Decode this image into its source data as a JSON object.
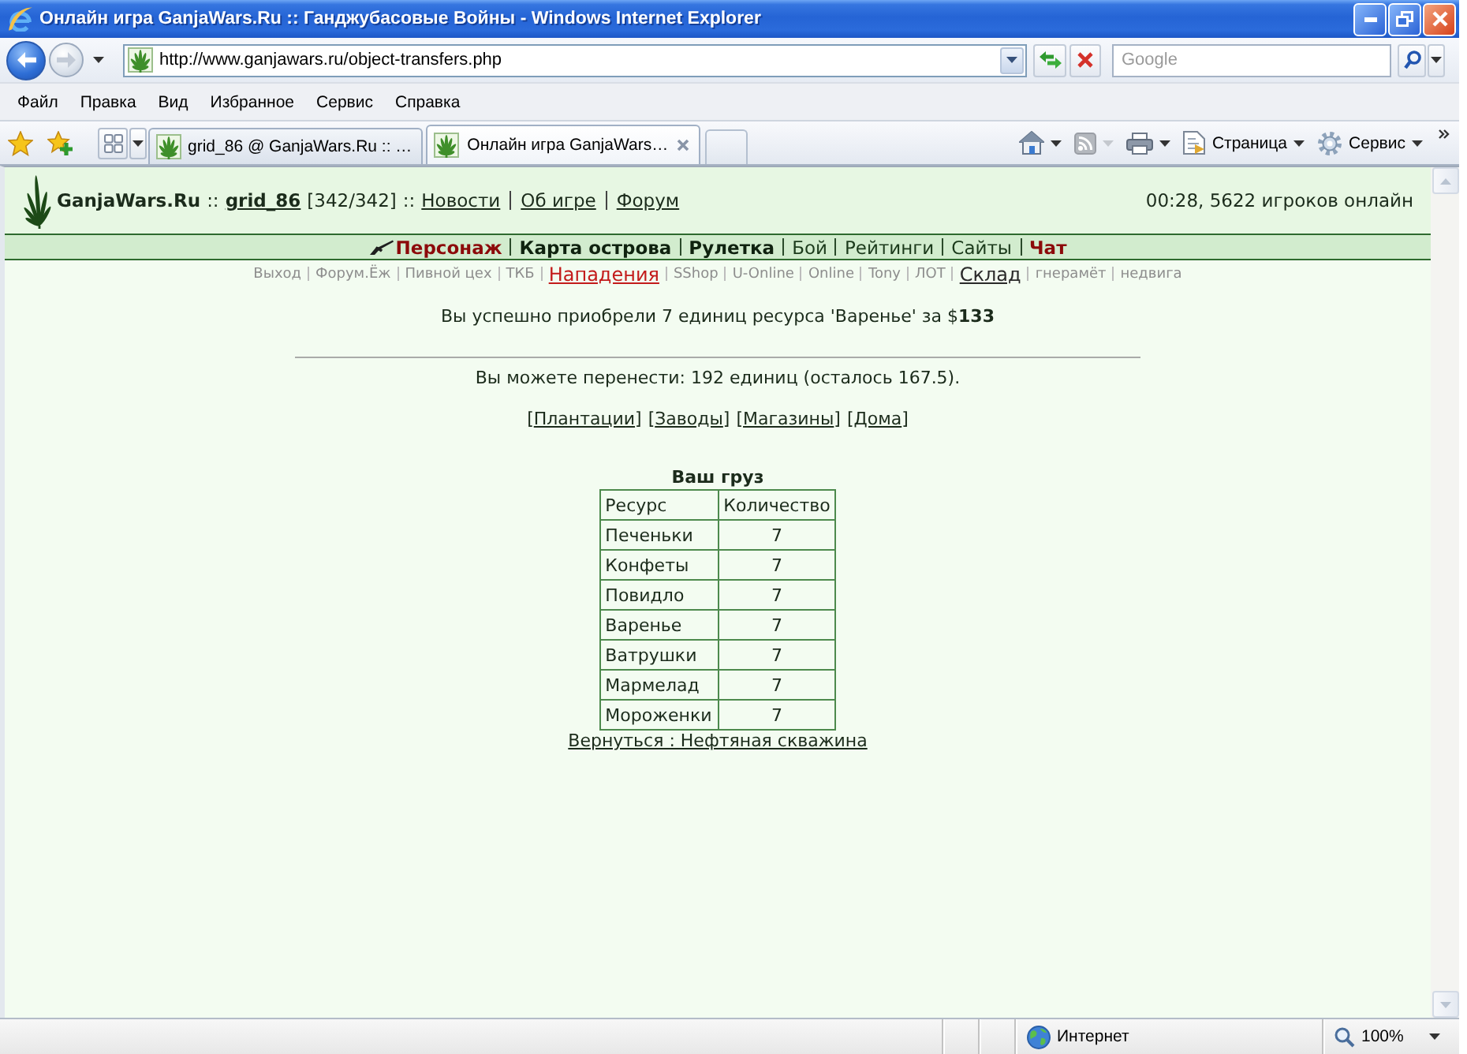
{
  "window": {
    "title": "Онлайн игра GanjaWars.Ru :: Ганджубасовые Войны - Windows Internet Explorer"
  },
  "address_bar": {
    "url": "http://www.ganjawars.ru/object-transfers.php"
  },
  "search": {
    "placeholder": "Google"
  },
  "menu": [
    "Файл",
    "Правка",
    "Вид",
    "Избранное",
    "Сервис",
    "Справка"
  ],
  "tabs": [
    {
      "label": "grid_86 @ GanjaWars.Ru :: …",
      "selected": false
    },
    {
      "label": "Онлайн игра GanjaWars…",
      "selected": true
    }
  ],
  "command_bar": {
    "page_label": "Страница",
    "tools_label": "Сервис"
  },
  "page": {
    "header": {
      "site_name": "GanjaWars.Ru",
      "separators": [
        "::",
        "::"
      ],
      "user": "grid_86",
      "health": "[342/342]",
      "links": [
        "Новости",
        "Об игре",
        "Форум"
      ],
      "online": "00:28, 5622 игроков онлайн"
    },
    "nav": [
      {
        "label": "Персонаж",
        "kind": "highlight"
      },
      {
        "label": "Карта острова",
        "kind": "bold"
      },
      {
        "label": "Рулетка",
        "kind": "bold"
      },
      {
        "label": "Бой",
        "kind": "plain"
      },
      {
        "label": "Рейтинги",
        "kind": "plain"
      },
      {
        "label": "Сайты",
        "kind": "plain"
      },
      {
        "label": "Чат",
        "kind": "highlight"
      }
    ],
    "subnav": [
      {
        "label": "Выход",
        "kind": "plain"
      },
      {
        "label": "Форум.Ёж",
        "kind": "plain"
      },
      {
        "label": "Пивной цех",
        "kind": "plain"
      },
      {
        "label": "ТКБ",
        "kind": "plain"
      },
      {
        "label": "Нападения",
        "kind": "alert"
      },
      {
        "label": "SShop",
        "kind": "plain"
      },
      {
        "label": "U-Online",
        "kind": "plain"
      },
      {
        "label": "Online",
        "kind": "plain"
      },
      {
        "label": "Tony",
        "kind": "plain"
      },
      {
        "label": "ЛОТ",
        "kind": "plain"
      },
      {
        "label": "Склад",
        "kind": "large"
      },
      {
        "label": "гнерамёт",
        "kind": "plain"
      },
      {
        "label": "недвига",
        "kind": "plain"
      }
    ],
    "message": "Вы успешно приобрели 7 единиц ресурса 'Варенье' за $**133**",
    "capacity": "Вы можете перенести: 192 единиц (осталось 167.5).",
    "categories": [
      {
        "open": "[",
        "label": "Плантации",
        "close": "]"
      },
      {
        "open": "[",
        "label": "Заводы",
        "close": "]"
      },
      {
        "open": "[",
        "label": "Магазины",
        "close": "]"
      },
      {
        "open": "[",
        "label": "Дома",
        "close": "]"
      }
    ],
    "cargo": {
      "title": "Ваш груз",
      "columns": [
        "Ресурс",
        "Количество"
      ],
      "rows": [
        [
          "Печеньки",
          "7"
        ],
        [
          "Конфеты",
          "7"
        ],
        [
          "Повидло",
          "7"
        ],
        [
          "Варенье",
          "7"
        ],
        [
          "Ватрушки",
          "7"
        ],
        [
          "Мармелад",
          "7"
        ],
        [
          "Мороженки",
          "7"
        ]
      ]
    },
    "back_link": "Вернуться : Нефтяная скважина"
  },
  "status_bar": {
    "zone": "Интернет",
    "zoom": "100%"
  }
}
